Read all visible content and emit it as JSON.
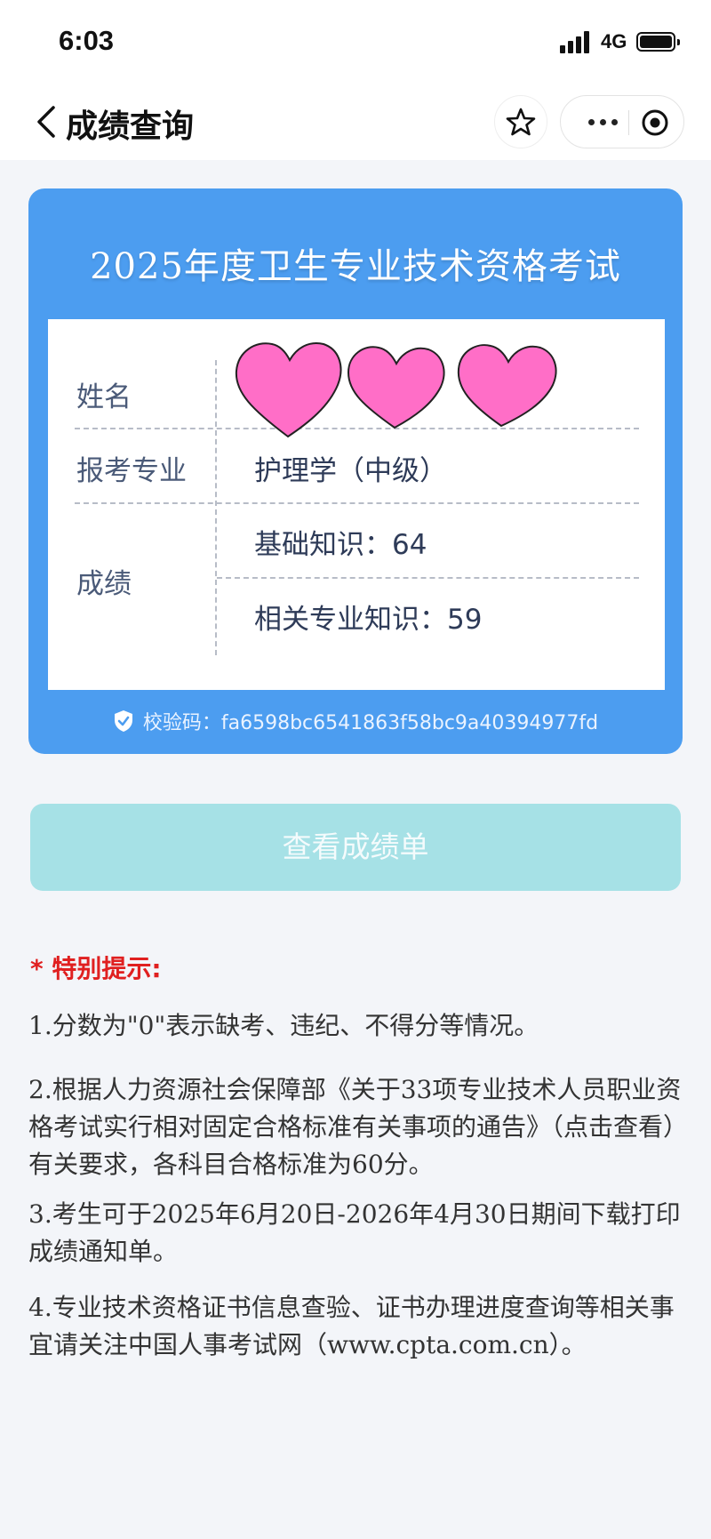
{
  "status_bar": {
    "time": "6:03",
    "network": "4G"
  },
  "nav": {
    "title": "成绩查询"
  },
  "card": {
    "title": "2025年度卫生专业技术资格考试",
    "rows": {
      "name_label": "姓名",
      "major_label": "报考专业",
      "major_value": "护理学（中级）",
      "score_label": "成绩",
      "score_1": "基础知识：64",
      "score_2": "相关专业知识：59"
    },
    "check_code": "校验码：fa6598bc6541863f58bc9a40394977fd"
  },
  "button": {
    "label": "查看成绩单"
  },
  "notices": {
    "title": "* 特别提示:",
    "items": [
      "1.分数为\"0\"表示缺考、违纪、不得分等情况。",
      "2.根据人力资源社会保障部《关于33项专业技术人员职业资格考试实行相对固定合格标准有关事项的通告》（点击查看）有关要求，各科目合格标准为60分。",
      "3.考生可于2025年6月20日-2026年4月30日期间下载打印成绩通知单。",
      "4.专业技术资格证书信息查验、证书办理进度查询等相关事宜请关注中国人事考试网（www.cpta.com.cn）。"
    ]
  },
  "colors": {
    "card_bg": "#4c9df0",
    "button_bg": "#a6e1e6",
    "notice_red": "#e02020",
    "heart_pink": "#ff6ec7"
  },
  "icons": [
    "back-arrow-icon",
    "star-icon",
    "more-dots-icon",
    "target-icon",
    "shield-check-icon",
    "heart-sticker-icon"
  ]
}
